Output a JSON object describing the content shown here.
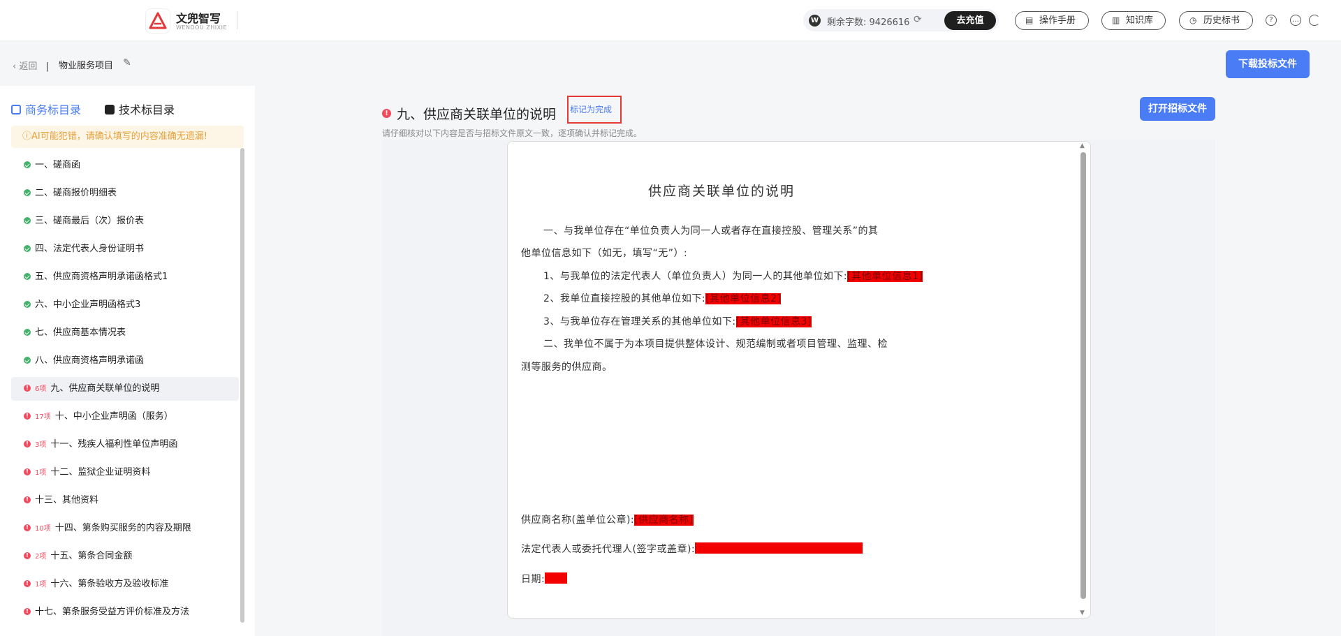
{
  "header": {
    "logo_name": "文兜智写",
    "logo_sub": "WENDOU ZHIXIE",
    "credits_label": "剩余字数:",
    "credits_value": "9426616",
    "recharge": "去充值",
    "manual": "操作手册",
    "knowledge": "知识库",
    "history": "历史标书"
  },
  "subheader": {
    "back": "返回",
    "project": "物业服务项目",
    "download": "下载投标文件"
  },
  "sidebar": {
    "tab_business": "商务标目录",
    "tab_tech": "技术标目录",
    "warning": "ⓘAI可能犯错，请确认填写的内容准确无遗漏!",
    "items": [
      {
        "status": "done",
        "badge": "",
        "label": "一、磋商函"
      },
      {
        "status": "done",
        "badge": "",
        "label": "二、磋商报价明细表"
      },
      {
        "status": "done",
        "badge": "",
        "label": "三、磋商最后（次）报价表"
      },
      {
        "status": "done",
        "badge": "",
        "label": "四、法定代表人身份证明书"
      },
      {
        "status": "done",
        "badge": "",
        "label": "五、供应商资格声明承诺函格式1"
      },
      {
        "status": "done",
        "badge": "",
        "label": "六、中小企业声明函格式3"
      },
      {
        "status": "done",
        "badge": "",
        "label": "七、供应商基本情况表"
      },
      {
        "status": "done",
        "badge": "",
        "label": "八、供应商资格声明承诺函"
      },
      {
        "status": "todo",
        "badge": "6项",
        "label": "九、供应商关联单位的说明"
      },
      {
        "status": "todo",
        "badge": "17项",
        "label": "十、中小企业声明函（服务）"
      },
      {
        "status": "todo",
        "badge": "3项",
        "label": "十一、残疾人福利性单位声明函"
      },
      {
        "status": "todo",
        "badge": "1项",
        "label": "十二、监狱企业证明资料"
      },
      {
        "status": "todo",
        "badge": "",
        "label": "十三、其他资料"
      },
      {
        "status": "todo",
        "badge": "10项",
        "label": "十四、第条购买服务的内容及期限"
      },
      {
        "status": "todo",
        "badge": "2项",
        "label": "十五、第条合同金额"
      },
      {
        "status": "todo",
        "badge": "1项",
        "label": "十六、第条验收方及验收标准"
      },
      {
        "status": "todo",
        "badge": "",
        "label": "十七、第条服务受益方评价标准及方法"
      }
    ]
  },
  "main": {
    "title": "九、供应商关联单位的说明",
    "mark_done": "标记为完成",
    "subtitle": "请仔细核对以下内容是否与招标文件原文一致，逐项确认并标记完成。",
    "open_file": "打开招标文件"
  },
  "document": {
    "heading": "供应商关联单位的说明",
    "p1a": "一、与我单位存在“单位负责人为同一人或者存在直接控股、管理关系”的其",
    "p1b": "他单位信息如下（如无，填写“无”）:",
    "l1": "1、与我单位的法定代表人（单位负责人）为同一人的其他单位如下:",
    "l1_fill": "[其他单位信息1]",
    "l2": "2、我单位直接控股的其他单位如下:",
    "l2_fill": "[其他单位信息2]",
    "l3": "3、与我单位存在管理关系的其他单位如下:",
    "l3_fill": "[其他单位信息3]",
    "p2a": "二、我单位不属于为本项目提供整体设计、规范编制或者项目管理、监理、检",
    "p2b": "测等服务的供应商。",
    "sig1": "供应商名称(盖单位公章):",
    "sig1_fill": "[供应商名称]",
    "sig2": "法定代表人或委托代理人(签字或盖章):",
    "date": "日期:"
  }
}
